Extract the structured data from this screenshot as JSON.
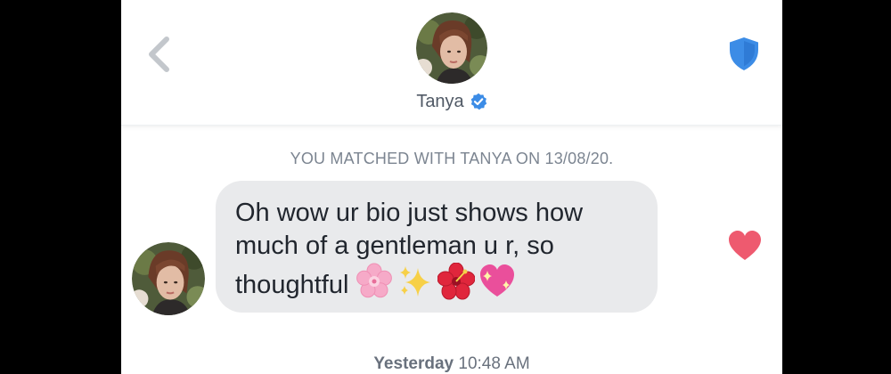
{
  "header": {
    "back_icon": "chevron-left-icon",
    "name": "Tanya",
    "verified_icon": "verified-check-icon",
    "safety_icon": "shield-icon",
    "colors": {
      "accent_blue": "#3c8ce6",
      "name_text": "#505965"
    }
  },
  "conversation": {
    "match_notice": "YOU MATCHED WITH TANYA ON 13/08/20.",
    "message": {
      "text": "Oh wow ur bio just shows how much of a gentleman u r, so thoughtful",
      "emojis": [
        "cherry-blossom",
        "sparkles",
        "hibiscus",
        "sparkling-heart"
      ],
      "like_icon": "heart-icon",
      "like_color": "#ee5a6f",
      "bubble_color": "#e9eaec"
    },
    "timestamp_day": "Yesterday",
    "timestamp_time": "10:48 AM"
  }
}
